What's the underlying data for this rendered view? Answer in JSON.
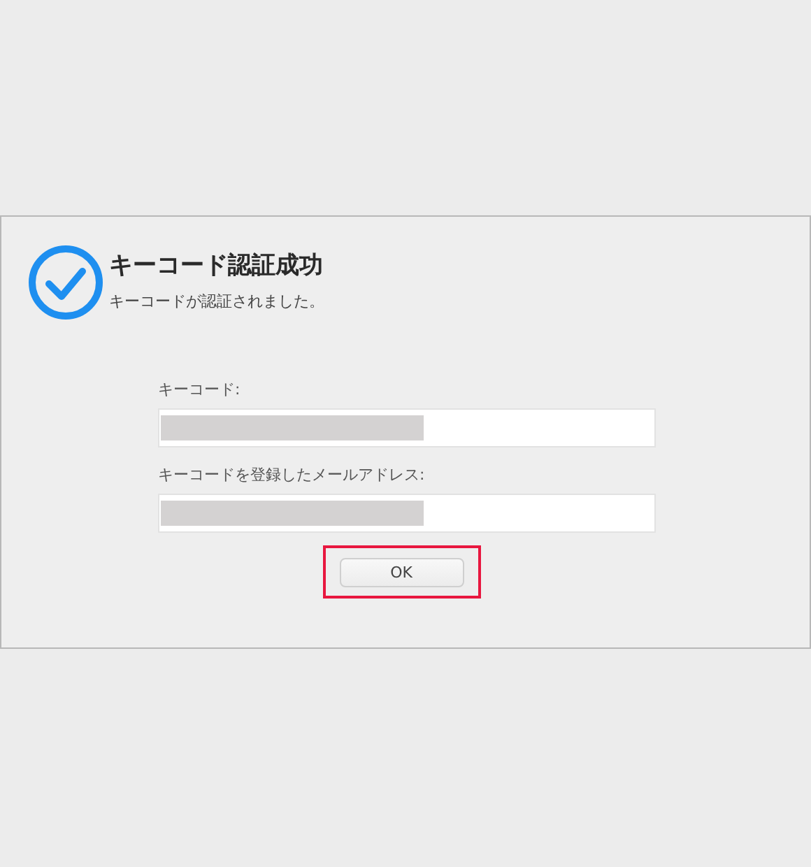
{
  "dialog": {
    "title": "キーコード認証成功",
    "message": "キーコードが認証されました。",
    "fields": [
      {
        "label": "キーコード:",
        "redacted": true
      },
      {
        "label": "キーコードを登録したメールアドレス:",
        "redacted": true
      }
    ],
    "button": {
      "label": "OK",
      "highlighted": true
    }
  }
}
